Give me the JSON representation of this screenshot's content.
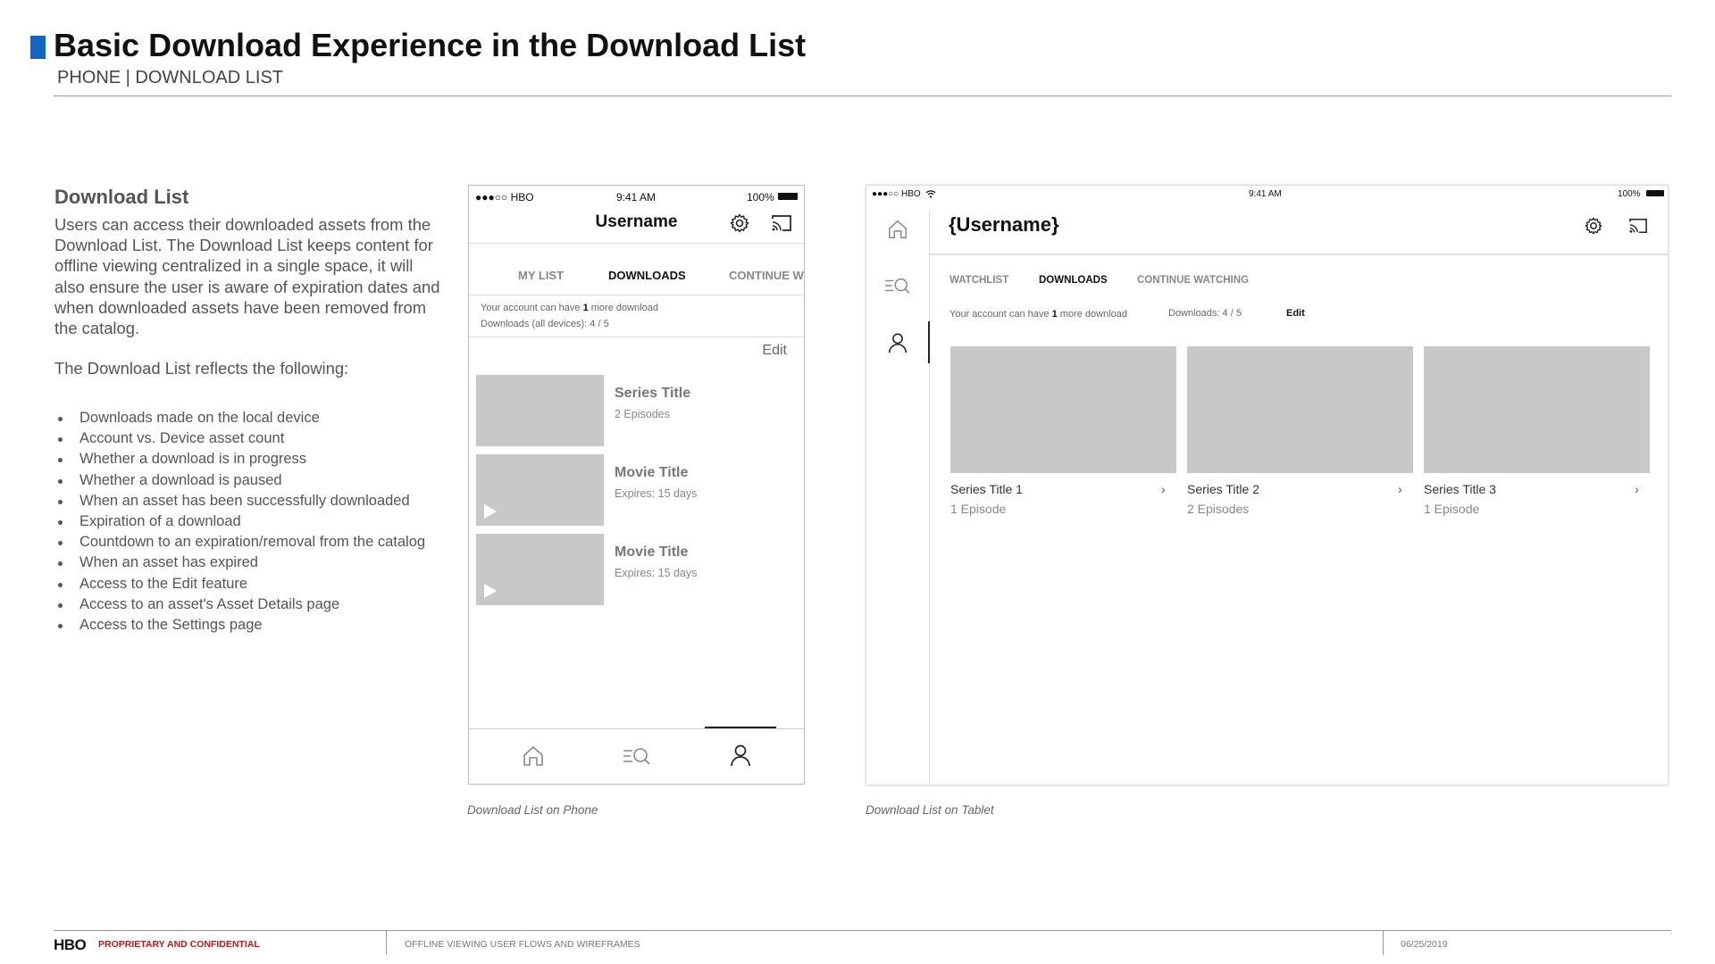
{
  "header": {
    "title": "Basic Download Experience in the Download List",
    "subtitle": "PHONE | DOWNLOAD LIST",
    "accent_color": "#1565c0"
  },
  "description": {
    "title": "Download List",
    "paragraph": "Users can access their downloaded assets from the Download List.  The Download List keeps content for offline viewing centralized in a single space, it will also ensure the user is aware of expiration dates and when downloaded assets have been removed from the catalog.",
    "intro": "The Download List reflects the following:",
    "bullets": [
      "Downloads made on the local device",
      "Account vs. Device asset count",
      "Whether a download is in progress",
      "Whether a download is paused",
      "When an asset has been successfully downloaded",
      "Expiration of a download",
      "Countdown to an expiration/removal from the catalog",
      "When an asset has expired",
      "Access to the Edit feature",
      "Access to an asset's Asset Details page",
      "Access to the Settings page"
    ]
  },
  "phone": {
    "status": {
      "carrier": "●●●○○ HBO",
      "time": "9:41 AM",
      "battery": "100%"
    },
    "username": "Username",
    "icons": [
      "settings-icon",
      "cast-icon"
    ],
    "tabs": [
      "MY LIST",
      "DOWNLOADS",
      "CONTINUE W"
    ],
    "active_tab": "DOWNLOADS",
    "account_line_pre": "Your account can have ",
    "account_count": "1",
    "account_line_post": " more download",
    "downloads_label": "Downloads (all devices):",
    "downloads_value": "4 / 5",
    "edit": "Edit",
    "items": [
      {
        "title": "Series Title",
        "sub": "2 Episodes",
        "play": false
      },
      {
        "title": "Movie Title",
        "sub": "Expires: 15 days",
        "play": true
      },
      {
        "title": "Movie Title",
        "sub": "Expires: 15 days",
        "play": true
      }
    ],
    "nav": [
      "home-icon",
      "search-icon",
      "profile-icon"
    ],
    "caption": "Download List on Phone"
  },
  "tablet": {
    "status": {
      "carrier": "●●●○○ HBO",
      "time": "9:41 AM",
      "battery": "100%"
    },
    "username": "{Username}",
    "tabs": [
      "WATCHLIST",
      "DOWNLOADS",
      "CONTINUE WATCHING"
    ],
    "active_tab": "DOWNLOADS",
    "account_line_pre": "Your account can have ",
    "account_count": "1",
    "account_line_post": " more download",
    "downloads_text": "Downloads: 4 / 5",
    "edit": "Edit",
    "cards": [
      {
        "title": "Series Title 1",
        "sub": "1 Episode"
      },
      {
        "title": "Series Title 2",
        "sub": "2 Episodes"
      },
      {
        "title": "Series Title 3",
        "sub": "1 Episode"
      }
    ],
    "caption": "Download List on Tablet"
  },
  "footer": {
    "logo": "HBO",
    "confidential": "PROPRIETARY AND CONFIDENTIAL",
    "doc_title": "OFFLINE VIEWING USER FLOWS AND WIREFRAMES",
    "date": "06/25/2019"
  }
}
